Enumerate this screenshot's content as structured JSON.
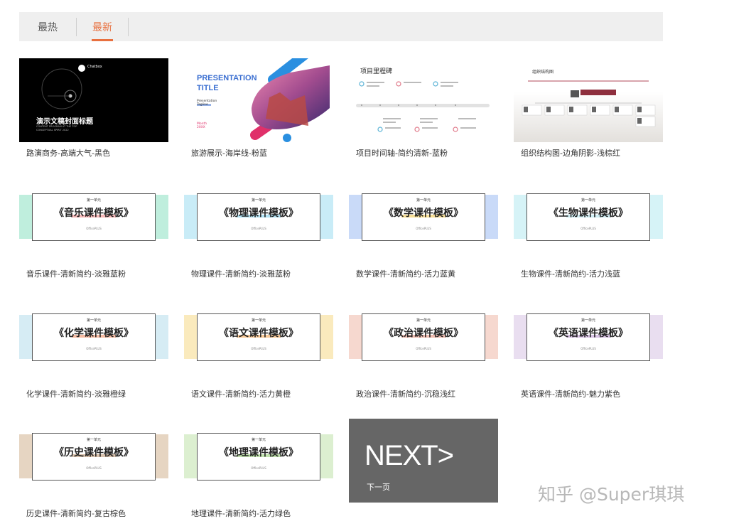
{
  "tabs": {
    "hot": "最热",
    "new": "最新"
  },
  "templates": [
    {
      "caption": "路演商务-高端大气-黑色",
      "thumb_title": "演示文稿封面标题",
      "thumb_sub": "CONTENT PROGRAM AT THE TOP\nCONCEPTUAL SPIRIT 2022",
      "logo": "Chatbox"
    },
    {
      "caption": "旅游展示-海岸线-粉蓝",
      "thumb_title": "PRESENTATION\nTITLE",
      "thumb_sub": "Presentation Tagline",
      "thumb_date": "Month 20XX"
    },
    {
      "caption": "项目时间轴-简约清新-蓝粉",
      "thumb_title": "项目里程碑"
    },
    {
      "caption": "组织结构图-边角阴影-浅棕红",
      "thumb_title": "组织结构图"
    },
    {
      "caption": "音乐课件-清新简约-淡雅蓝粉",
      "unit": "第一单元",
      "title": "《音乐课件模板》",
      "sub": "OfficePLUS",
      "bar": "#bfeedd",
      "under": "#f39a9a"
    },
    {
      "caption": "物理课件-清新简约-淡雅蓝粉",
      "unit": "第一单元",
      "title": "《物理课件模板》",
      "sub": "OfficePLUS",
      "bar": "#c9ecf7",
      "under": "#8fd5f0"
    },
    {
      "caption": "数学课件-清新简约-活力蓝黄",
      "unit": "第一单元",
      "title": "《数学课件模板》",
      "sub": "OfficePLUS",
      "bar": "#c9daf8",
      "under": "#f5d26a"
    },
    {
      "caption": "生物课件-清新简约-活力浅蓝",
      "unit": "第一单元",
      "title": "《生物课件模板》",
      "sub": "OfficePLUS",
      "bar": "#d6f3f7",
      "under": "#b9e6ee"
    },
    {
      "caption": "化学课件-清新简约-淡雅橙绿",
      "unit": "第一单元",
      "title": "《化学课件模板》",
      "sub": "OfficePLUS",
      "bar": "#d6ecf4",
      "under": "#f3a07c"
    },
    {
      "caption": "语文课件-清新简约-活力黄橙",
      "unit": "第一单元",
      "title": "《语文课件模板》",
      "sub": "OfficePLUS",
      "bar": "#faeabd",
      "under": "#f6b36c"
    },
    {
      "caption": "政治课件-清新简约-沉稳浅红",
      "unit": "第一单元",
      "title": "《政治课件模板》",
      "sub": "OfficePLUS",
      "bar": "#f6d8cf",
      "under": "#e89f8e"
    },
    {
      "caption": "英语课件-清新简约-魅力紫色",
      "unit": "第一单元",
      "title": "《英语课件模板》",
      "sub": "OfficePLUS",
      "bar": "#e9def0",
      "under": "#c7a8d8"
    },
    {
      "caption": "历史课件-清新简约-复古棕色",
      "unit": "第一单元",
      "title": "《历史课件模板》",
      "sub": "OfficePLUS",
      "bar": "#e6d5c2",
      "under": "#c9a88a"
    },
    {
      "caption": "地理课件-清新简约-活力绿色",
      "unit": "第一单元",
      "title": "《地理课件模板》",
      "sub": "OfficePLUS",
      "bar": "#dcefd0",
      "under": "#a7d58c"
    }
  ],
  "next": {
    "big": "NEXT>",
    "small": "下一页"
  },
  "watermark": "知乎 @Super琪琪",
  "colors": {
    "accent": "#e8703f",
    "next_bg": "#666666"
  }
}
